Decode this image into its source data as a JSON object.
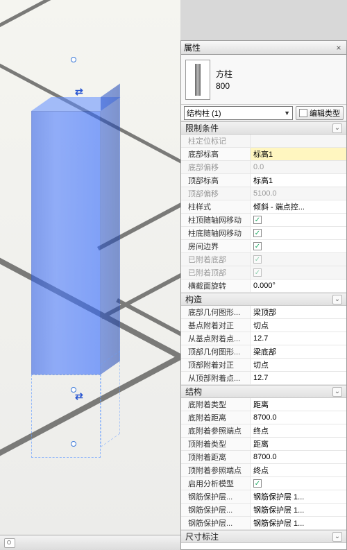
{
  "panel": {
    "title": "属性",
    "close": "×"
  },
  "type": {
    "family": "方柱",
    "size": "800"
  },
  "instance": {
    "selector": "结构柱 (1)",
    "edit_label": "编辑类型"
  },
  "groups": {
    "constraints": "限制条件",
    "construction": "构造",
    "structure": "结构",
    "dimensions": "尺寸标注"
  },
  "rows": {
    "loc_mark": {
      "l": "柱定位标记",
      "v": ""
    },
    "base_level": {
      "l": "底部标高",
      "v": "标高1"
    },
    "base_offset": {
      "l": "底部偏移",
      "v": "0.0"
    },
    "top_level": {
      "l": "顶部标高",
      "v": "标高1"
    },
    "top_offset": {
      "l": "顶部偏移",
      "v": "5100.0"
    },
    "col_style": {
      "l": "柱样式",
      "v": "倾斜 - 端点控..."
    },
    "move_top": {
      "l": "柱顶随轴网移动",
      "v": true
    },
    "move_base": {
      "l": "柱底随轴网移动",
      "v": true
    },
    "room_bound": {
      "l": "房间边界",
      "v": true
    },
    "att_base": {
      "l": "已附着底部",
      "v": true
    },
    "att_top": {
      "l": "已附着顶部",
      "v": true
    },
    "sec_rot": {
      "l": "横截面旋转",
      "v": "0.000°"
    },
    "base_geom": {
      "l": "底部几何图形...",
      "v": "梁顶部"
    },
    "base_just": {
      "l": "基点附着对正",
      "v": "切点"
    },
    "base_pt": {
      "l": "从基点附着点...",
      "v": "12.7"
    },
    "top_geom": {
      "l": "顶部几何图形...",
      "v": "梁底部"
    },
    "top_just": {
      "l": "顶部附着对正",
      "v": "切点"
    },
    "top_pt": {
      "l": "从顶部附着点...",
      "v": "12.7"
    },
    "base_att_type": {
      "l": "底附着类型",
      "v": "距离"
    },
    "base_att_dist": {
      "l": "底附着距离",
      "v": "8700.0"
    },
    "base_ref_pt": {
      "l": "底附着参照端点",
      "v": "终点"
    },
    "top_att_type": {
      "l": "顶附着类型",
      "v": "距离"
    },
    "top_att_dist": {
      "l": "顶附着距离",
      "v": "8700.0"
    },
    "top_ref_pt": {
      "l": "顶附着参照端点",
      "v": "终点"
    },
    "analytical": {
      "l": "启用分析模型",
      "v": true
    },
    "cover1": {
      "l": "钢筋保护层...",
      "v": "钢筋保护层 1..."
    },
    "cover2": {
      "l": "钢筋保护层...",
      "v": "钢筋保护层 1..."
    },
    "cover3": {
      "l": "钢筋保护层...",
      "v": "钢筋保护层 1..."
    }
  }
}
